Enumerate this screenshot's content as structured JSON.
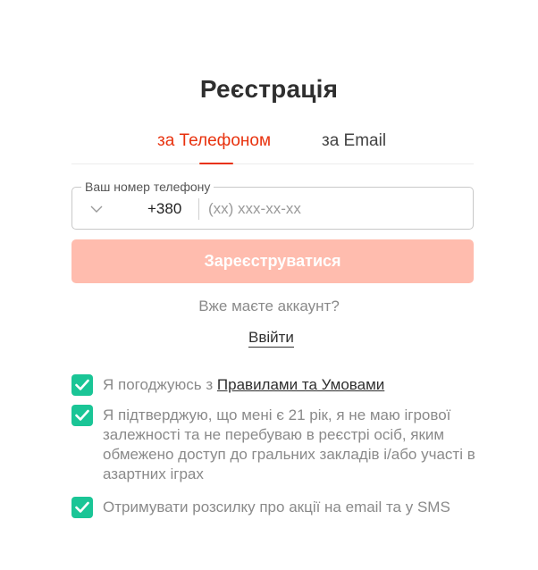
{
  "title": "Реєстрація",
  "tabs": {
    "phone": "за Телефоном",
    "email": "за Email"
  },
  "phone_field": {
    "legend": "Ваш номер телефону",
    "country_code": "+380",
    "placeholder": "(xx) xxx-xx-xx",
    "value": ""
  },
  "submit_label": "Зареєструватися",
  "have_account_text": "Вже маєте аккаунт?",
  "login_label": "Ввійти",
  "checkboxes": {
    "terms": {
      "checked": true,
      "prefix": "Я погоджуюсь з ",
      "link": "Правилами та Умовами"
    },
    "age": {
      "checked": true,
      "text": "Я підтверджую, що мені є 21 рік, я не маю ігрової залежності та не перебуваю в реєстрі осіб, яким обмежено доступ до гральних закладів і/або участі в азартних іграх"
    },
    "newsletter": {
      "checked": true,
      "text": "Отримувати розсилку про акції на email та у SMS"
    }
  },
  "colors": {
    "accent": "#e8320e",
    "submit_disabled": "#ffbcae",
    "checkbox": "#1ac596"
  },
  "icons": {
    "chevron": "chevron-down-icon",
    "check": "checkmark-icon"
  }
}
